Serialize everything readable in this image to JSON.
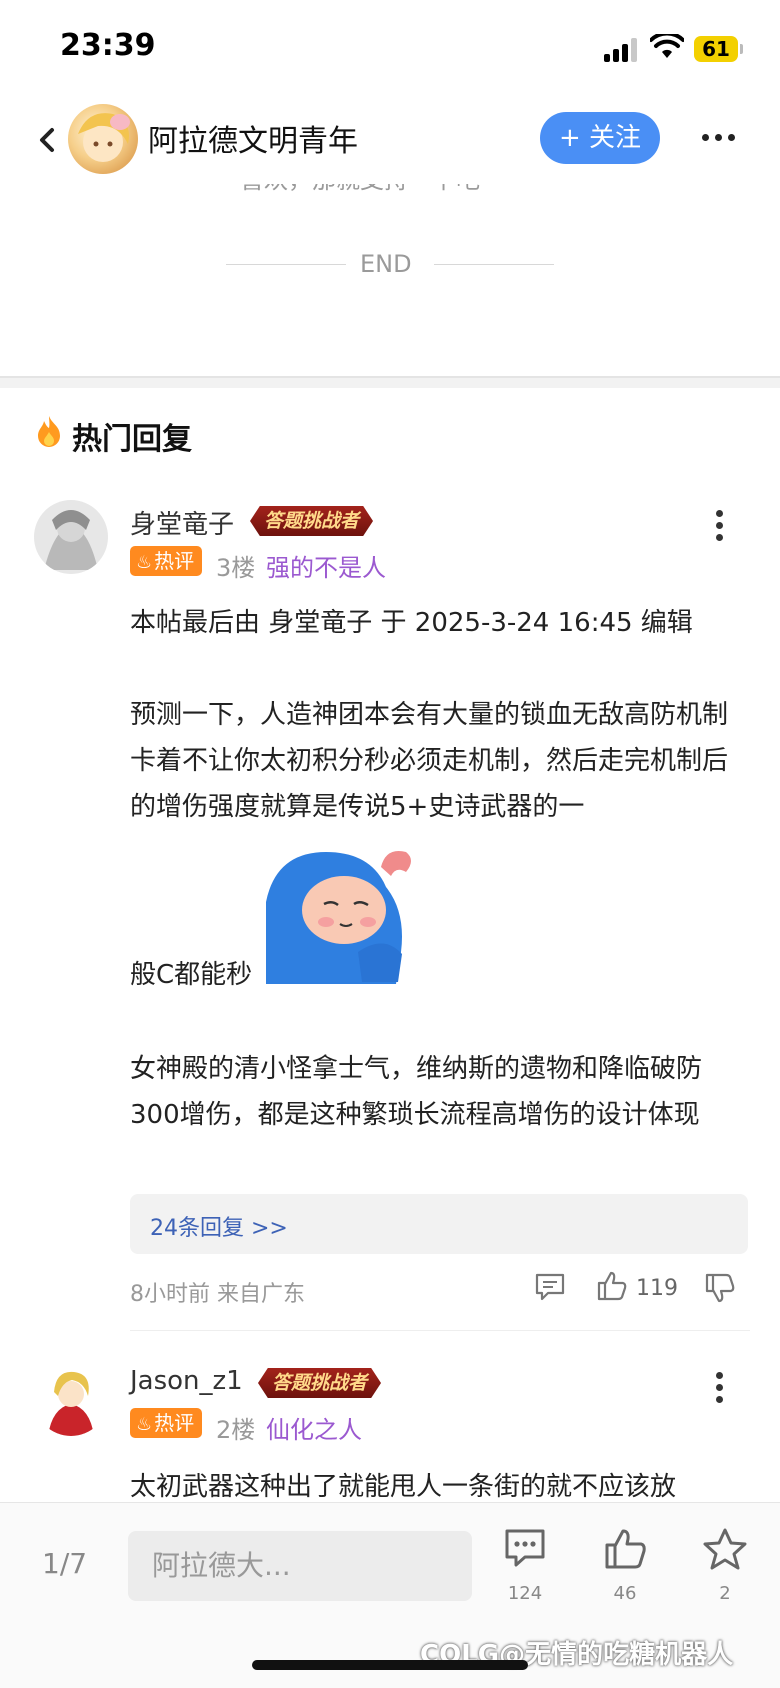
{
  "status_bar": {
    "time": "23:39",
    "battery": "61"
  },
  "header": {
    "title": "阿拉德文明青年",
    "follow_label": "+ 关注"
  },
  "article": {
    "prev_text": "喜欢，那就支持一下吧~",
    "end_label": "END"
  },
  "section": {
    "title": "热门回复"
  },
  "comments": [
    {
      "username": "身堂竜子",
      "badge": "答题挑战者",
      "hot_label": "热评",
      "floor": "3楼",
      "user_tag": "强的不是人",
      "body": {
        "line1": "本帖最后由 身堂竜子 于 2025-3-24 16:45 编辑",
        "para2": "预测一下，人造神团本会有大量的锁血无敌高防机制卡着不让你太初积分秒必须走机制，然后走完机制后的增伤强度就算是传说5+史诗武器的一",
        "line3": "般C都能秒",
        "para4": "女神殿的清小怪拿士气，维纳斯的遗物和降临破防300增伤，都是这种繁琐长流程高增伤的设计体现"
      },
      "replies_label": "24条回复 >>",
      "meta": "8小时前 来自广东",
      "likes": "119"
    },
    {
      "username": "Jason_z1",
      "badge": "答题挑战者",
      "hot_label": "热评",
      "floor": "2楼",
      "user_tag": "仙化之人",
      "body": {
        "line1": "太初武器这种出了就能甩人一条街的就不应该放"
      }
    }
  ],
  "bottom_bar": {
    "page": "1/7",
    "input_placeholder": "阿拉德大...",
    "comment_count": "124",
    "like_count": "46",
    "favorite_count": "2"
  },
  "watermark": "COLG@无情的吃糖机器人"
}
